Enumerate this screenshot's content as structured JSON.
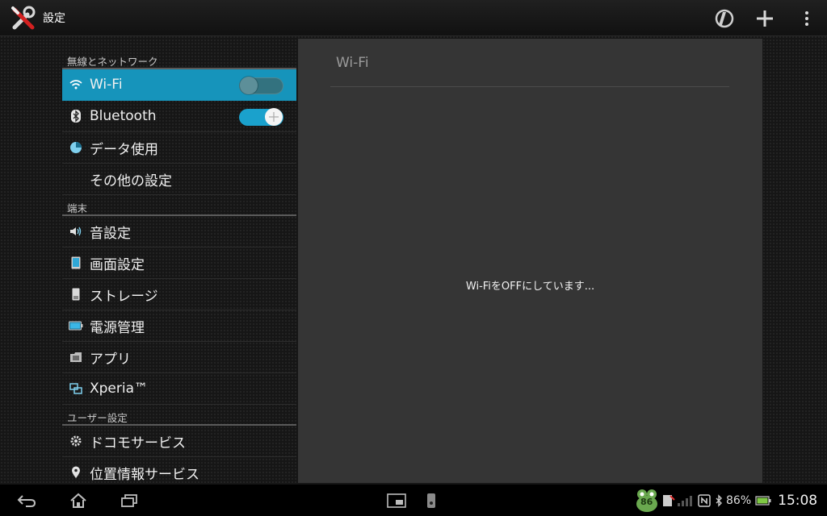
{
  "app": {
    "title": "設定"
  },
  "sections": [
    {
      "header": "無線とネットワーク",
      "items": [
        {
          "label": "Wi-Fi",
          "icon": "wifi-icon",
          "selected": true,
          "toggle": "off"
        },
        {
          "label": "Bluetooth",
          "icon": "bluetooth-icon",
          "toggle": "on"
        },
        {
          "label": "データ使用",
          "icon": "data-usage-icon"
        },
        {
          "label": "その他の設定",
          "icon": ""
        }
      ]
    },
    {
      "header": "端末",
      "items": [
        {
          "label": "音設定",
          "icon": "speaker-icon"
        },
        {
          "label": "画面設定",
          "icon": "display-icon"
        },
        {
          "label": "ストレージ",
          "icon": "storage-icon"
        },
        {
          "label": "電源管理",
          "icon": "battery-icon"
        },
        {
          "label": "アプリ",
          "icon": "apps-icon"
        },
        {
          "label": "Xperia™",
          "icon": "xperia-icon"
        }
      ]
    },
    {
      "header": "ユーザー設定",
      "items": [
        {
          "label": "ドコモサービス",
          "icon": "gear-icon"
        },
        {
          "label": "位置情報サービス",
          "icon": "location-pin-icon"
        }
      ]
    }
  ],
  "panel": {
    "title": "Wi-Fi",
    "message": "Wi-FiをOFFにしています..."
  },
  "status": {
    "badge": "86",
    "battery_percent": "86%",
    "time": "15:08"
  },
  "colors": {
    "accent": "#1694bb",
    "toggle_on": "#1aa1cc",
    "panel_bg": "#353535"
  }
}
